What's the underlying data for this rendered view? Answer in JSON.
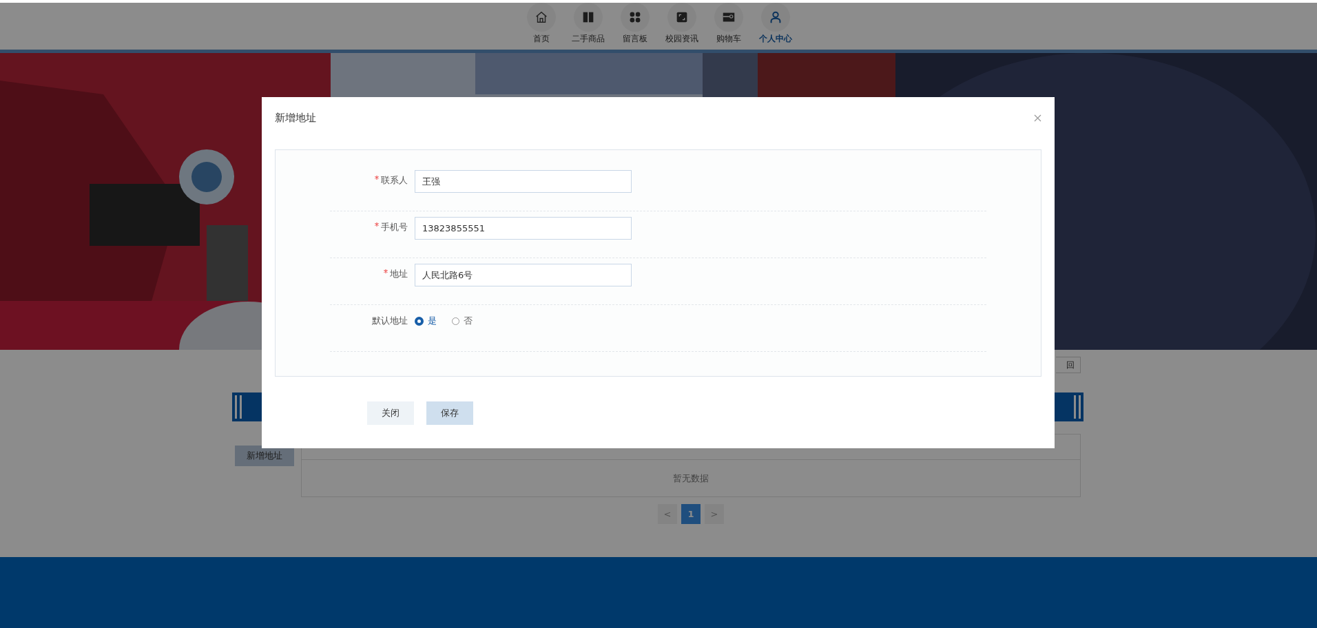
{
  "nav": {
    "items": [
      {
        "label": "首页",
        "selected": false
      },
      {
        "label": "二手商品",
        "selected": false
      },
      {
        "label": "留言板",
        "selected": false
      },
      {
        "label": "校园资讯",
        "selected": false
      },
      {
        "label": "购物车",
        "selected": false
      },
      {
        "label": "个人中心",
        "selected": true
      }
    ]
  },
  "content": {
    "back_button": "回",
    "add_button": "新增地址",
    "table": {
      "empty_text": "暂无数据"
    },
    "pagination": {
      "prev": "<",
      "pages": [
        {
          "label": "1",
          "selected": true
        }
      ],
      "next": ">"
    }
  },
  "dialog": {
    "title": "新增地址",
    "fields": [
      {
        "label": "联系人",
        "required": true,
        "value": "王强"
      },
      {
        "label": "手机号",
        "required": true,
        "value": "13823855551"
      },
      {
        "label": "地址",
        "required": true,
        "value": "人民北路6号"
      }
    ],
    "radio": {
      "label": "默认地址",
      "options": [
        {
          "label": "是",
          "selected": true
        },
        {
          "label": "否",
          "selected": false
        }
      ]
    },
    "buttons": [
      {
        "label": "关闭",
        "kind": "default"
      },
      {
        "label": "保存",
        "kind": "primary"
      }
    ]
  }
}
